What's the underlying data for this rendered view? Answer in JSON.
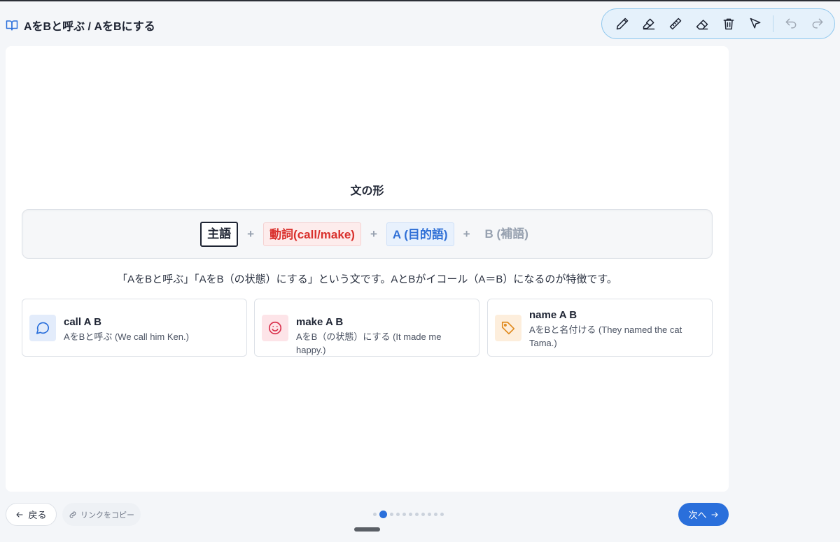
{
  "header": {
    "title": "AをBと呼ぶ / AをBにする",
    "icon": "book-open-icon"
  },
  "toolbar": {
    "tools": [
      "pen-icon",
      "highlighter-icon",
      "ruler-icon",
      "eraser-icon",
      "trash-icon",
      "pointer-icon",
      "undo-icon",
      "redo-icon"
    ]
  },
  "main": {
    "section_title": "文の形",
    "formula": {
      "subject": "主語",
      "plus": "+",
      "verb": "動詞(call/make)",
      "a": "A (目的語)",
      "b": "B (補語)"
    },
    "description": "「AをBと呼ぶ」「AをB（の状態）にする」という文です。AとBがイコール（A＝B）になるのが特徴です。",
    "examples": [
      {
        "title": "call A B",
        "text": "AをBと呼ぶ (We call him Ken.)",
        "icon": "speech-bubble-icon"
      },
      {
        "title": "make A B",
        "text": "AをB（の状態）にする (It made me happy.)",
        "icon": "smile-icon"
      },
      {
        "title": "name A B",
        "text": "AをBと名付ける (They named the cat Tama.)",
        "icon": "tag-icon"
      }
    ]
  },
  "footer": {
    "back_label": "戻る",
    "copy_label": "リンクをコピー",
    "next_label": "次へ",
    "page_count": 11,
    "current_page": 2
  },
  "colors": {
    "accent": "#2a6fdb",
    "verb": "#d9302c",
    "toolbar_bg": "#e5f1fb"
  }
}
